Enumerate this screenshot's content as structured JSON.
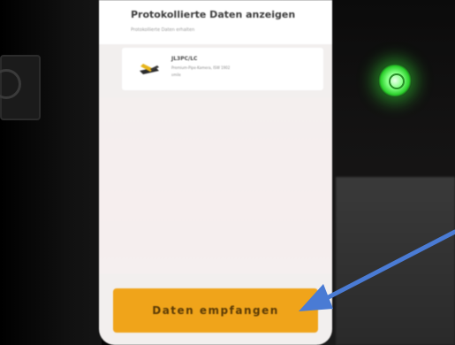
{
  "screen": {
    "title": "Protokollierte Daten anzeigen",
    "subtitle": "Protokollierte Daten erhalten",
    "device": {
      "name": "JL3PC/LC",
      "description": "Premium-Pipe-Kamera, ISW 1902",
      "extra": "smile",
      "icon": "pipe-camera-icon"
    },
    "action_button": {
      "label": "Daten empfangen",
      "color": "#f0a41a"
    }
  },
  "annotation": {
    "arrow_color": "#4a7bd4",
    "icon": "arrow-pointer-icon"
  }
}
